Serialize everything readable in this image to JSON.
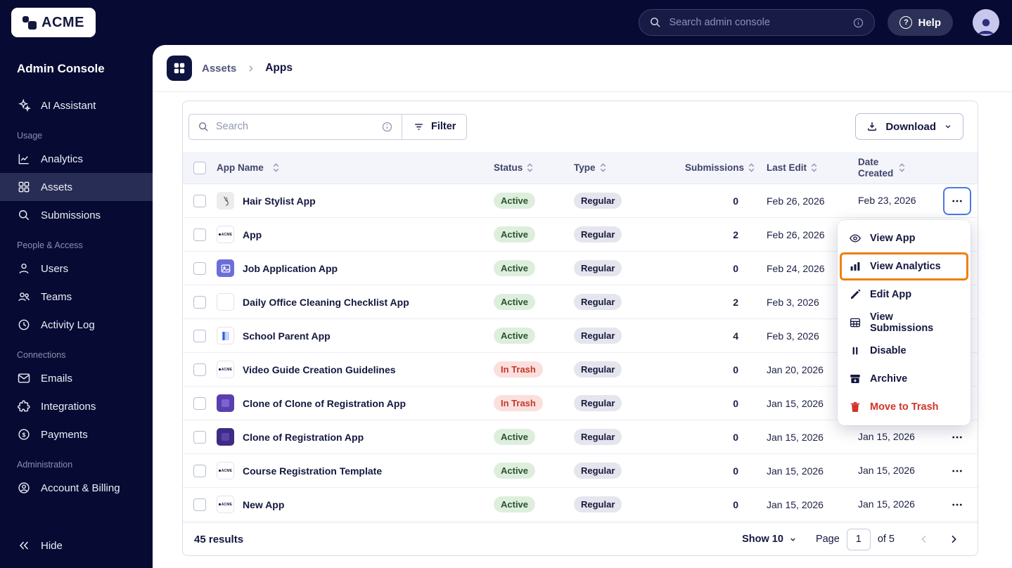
{
  "colors": {
    "navy": "#070b33",
    "panel_white": "#ffffff",
    "header_bg": "#f4f4fb",
    "accent_blue_outline": "#4d79e6",
    "annotation_orange": "#ee7f12",
    "active_badge_bg": "#ddefdc",
    "active_badge_text": "#2b5132",
    "trash_badge_bg": "#fbdfdd",
    "trash_badge_text": "#c0392b",
    "type_badge_bg": "#e5e5ee",
    "danger_red": "#d2342a"
  },
  "topbar": {
    "brand": "ACME",
    "search_placeholder": "Search admin console",
    "help_label": "Help"
  },
  "sidebar": {
    "title": "Admin Console",
    "assistant_label": "AI Assistant",
    "sections": [
      {
        "label": "Usage",
        "items": [
          "Analytics",
          "Assets",
          "Submissions"
        ]
      },
      {
        "label": "People & Access",
        "items": [
          "Users",
          "Teams",
          "Activity Log"
        ]
      },
      {
        "label": "Connections",
        "items": [
          "Emails",
          "Integrations",
          "Payments"
        ]
      },
      {
        "label": "Administration",
        "items": [
          "Account & Billing"
        ]
      }
    ],
    "hide_label": "Hide"
  },
  "breadcrumb": {
    "root": "Assets",
    "current": "Apps"
  },
  "toolbar": {
    "search_placeholder": "Search",
    "filter_label": "Filter",
    "download_label": "Download"
  },
  "table": {
    "headers": {
      "name": "App Name",
      "status": "Status",
      "type": "Type",
      "submissions": "Submissions",
      "last_edit": "Last Edit",
      "date_created": "Date Created"
    },
    "rows": [
      {
        "name": "Hair Stylist App",
        "status": "Active",
        "type": "Regular",
        "submissions": "0",
        "last_edit": "Feb 26, 2026",
        "date_created": "Feb 23, 2026"
      },
      {
        "name": "App",
        "status": "Active",
        "type": "Regular",
        "submissions": "2",
        "last_edit": "Feb 26, 2026",
        "date_created": ""
      },
      {
        "name": "Job Application App",
        "status": "Active",
        "type": "Regular",
        "submissions": "0",
        "last_edit": "Feb 24, 2026",
        "date_created": ""
      },
      {
        "name": "Daily Office Cleaning Checklist App",
        "status": "Active",
        "type": "Regular",
        "submissions": "2",
        "last_edit": "Feb 3, 2026",
        "date_created": ""
      },
      {
        "name": "School Parent App",
        "status": "Active",
        "type": "Regular",
        "submissions": "4",
        "last_edit": "Feb 3, 2026",
        "date_created": ""
      },
      {
        "name": "Video Guide Creation Guidelines",
        "status": "In Trash",
        "type": "Regular",
        "submissions": "0",
        "last_edit": "Jan 20, 2026",
        "date_created": ""
      },
      {
        "name": "Clone of Clone of Registration App",
        "status": "In Trash",
        "type": "Regular",
        "submissions": "0",
        "last_edit": "Jan 15, 2026",
        "date_created": ""
      },
      {
        "name": "Clone of Registration App",
        "status": "Active",
        "type": "Regular",
        "submissions": "0",
        "last_edit": "Jan 15, 2026",
        "date_created": "Jan 15, 2026"
      },
      {
        "name": "Course Registration Template",
        "status": "Active",
        "type": "Regular",
        "submissions": "0",
        "last_edit": "Jan 15, 2026",
        "date_created": "Jan 15, 2026"
      },
      {
        "name": "New App",
        "status": "Active",
        "type": "Regular",
        "submissions": "0",
        "last_edit": "Jan 15, 2026",
        "date_created": "Jan 15, 2026"
      }
    ]
  },
  "menu": {
    "items": [
      "View App",
      "View Analytics",
      "Edit App",
      "View Submissions",
      "Disable",
      "Archive",
      "Move to Trash"
    ]
  },
  "footer": {
    "results": "45 results",
    "show_label": "Show 10",
    "page_label": "Page",
    "page_value": "1",
    "of_label": "of 5"
  }
}
